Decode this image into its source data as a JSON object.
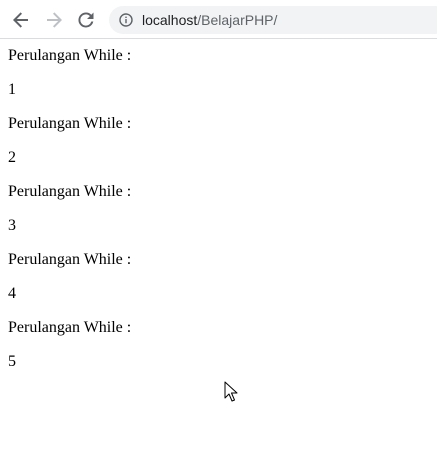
{
  "browser": {
    "url_host": "localhost",
    "url_path": "/BelajarPHP/"
  },
  "page": {
    "lines": [
      "Perulangan While :",
      "1",
      "Perulangan While :",
      "2",
      "Perulangan While :",
      "3",
      "Perulangan While :",
      "4",
      "Perulangan While :",
      "5"
    ]
  }
}
